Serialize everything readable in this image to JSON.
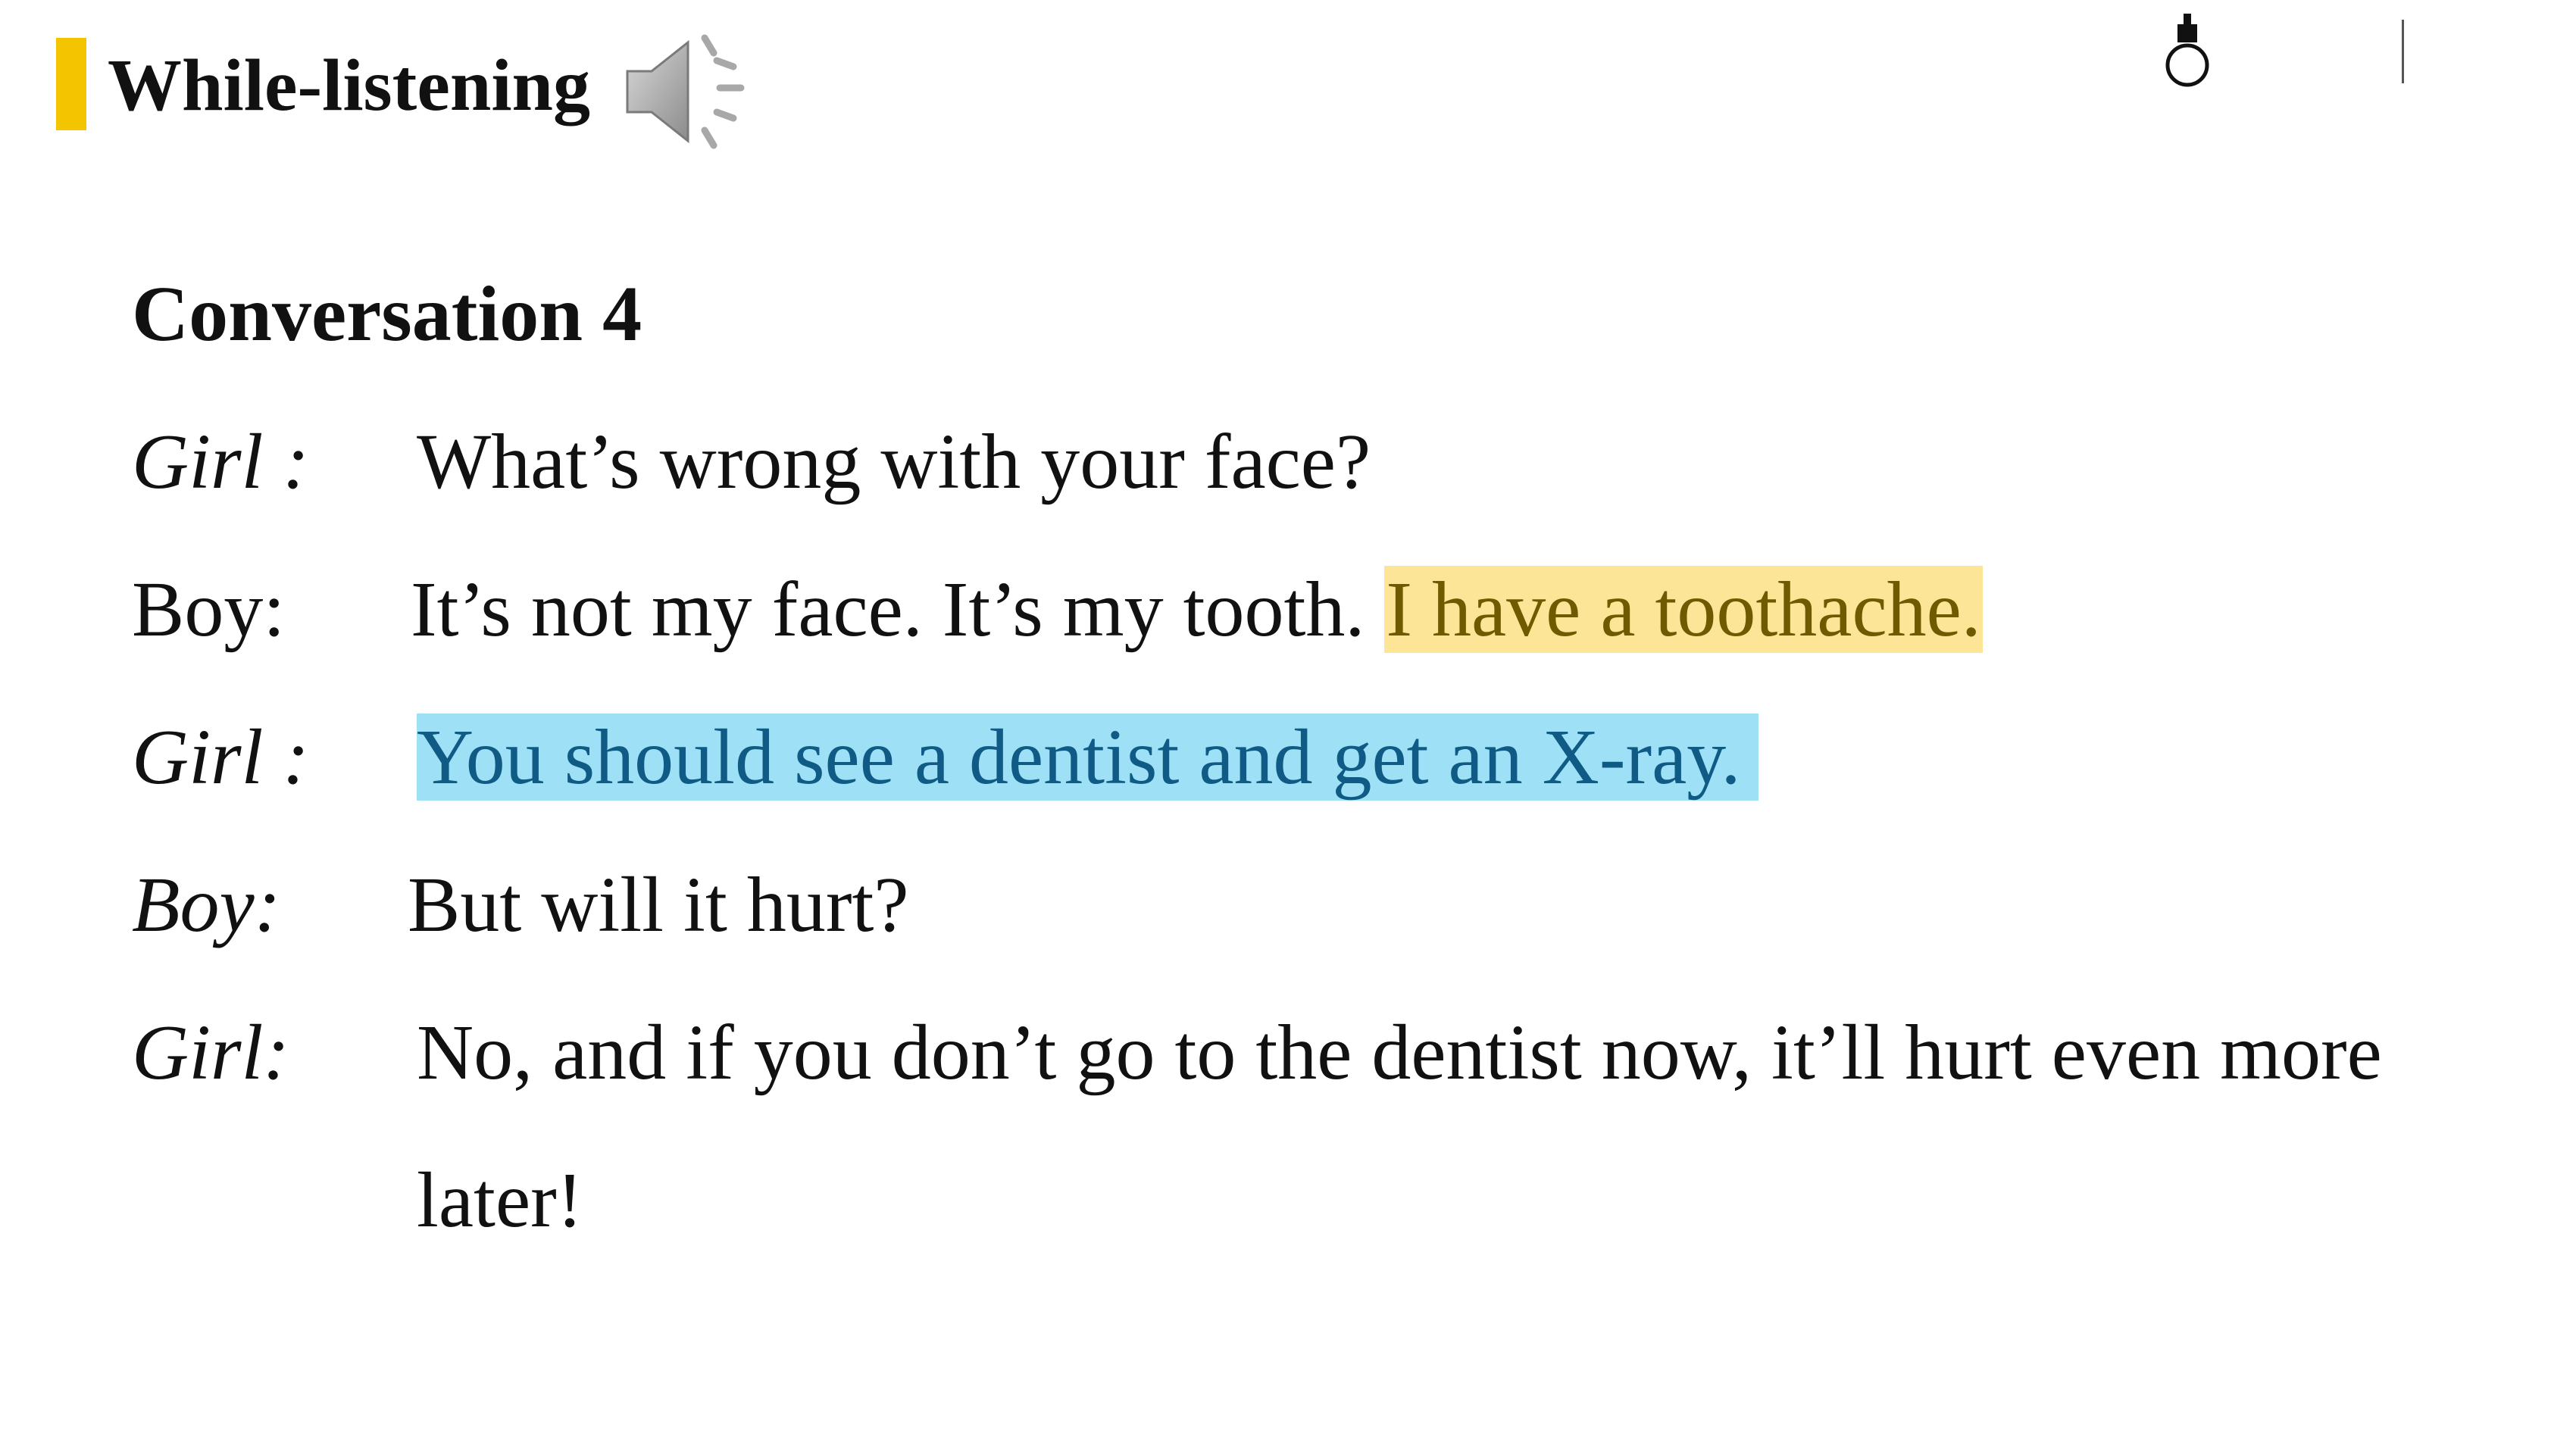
{
  "header": {
    "title": "While-listening"
  },
  "conversation": {
    "title": "Conversation 4",
    "lines": [
      {
        "speaker": "Girl :",
        "text": "What’s wrong with your face?"
      },
      {
        "speaker": "Boy:",
        "text": "It’s not my face. It’s my tooth.",
        "highlight": "I have a toothache."
      },
      {
        "speaker": "Girl :",
        "highlight": "You should see a dentist and get an X-ray."
      },
      {
        "speaker": "Boy:",
        "text": "But will it hurt?"
      },
      {
        "speaker": "Girl:",
        "text": "No, and if you don’t go to the dentist now, it’ll hurt even more"
      },
      {
        "text": "later!"
      }
    ]
  },
  "colors": {
    "accent_bar": "#f5c400",
    "highlight_yellow": "#fde597",
    "highlight_blue": "#9ee0f5"
  },
  "icons": {
    "audio": "speaker-icon",
    "bulb": "lightbulb-icon"
  }
}
